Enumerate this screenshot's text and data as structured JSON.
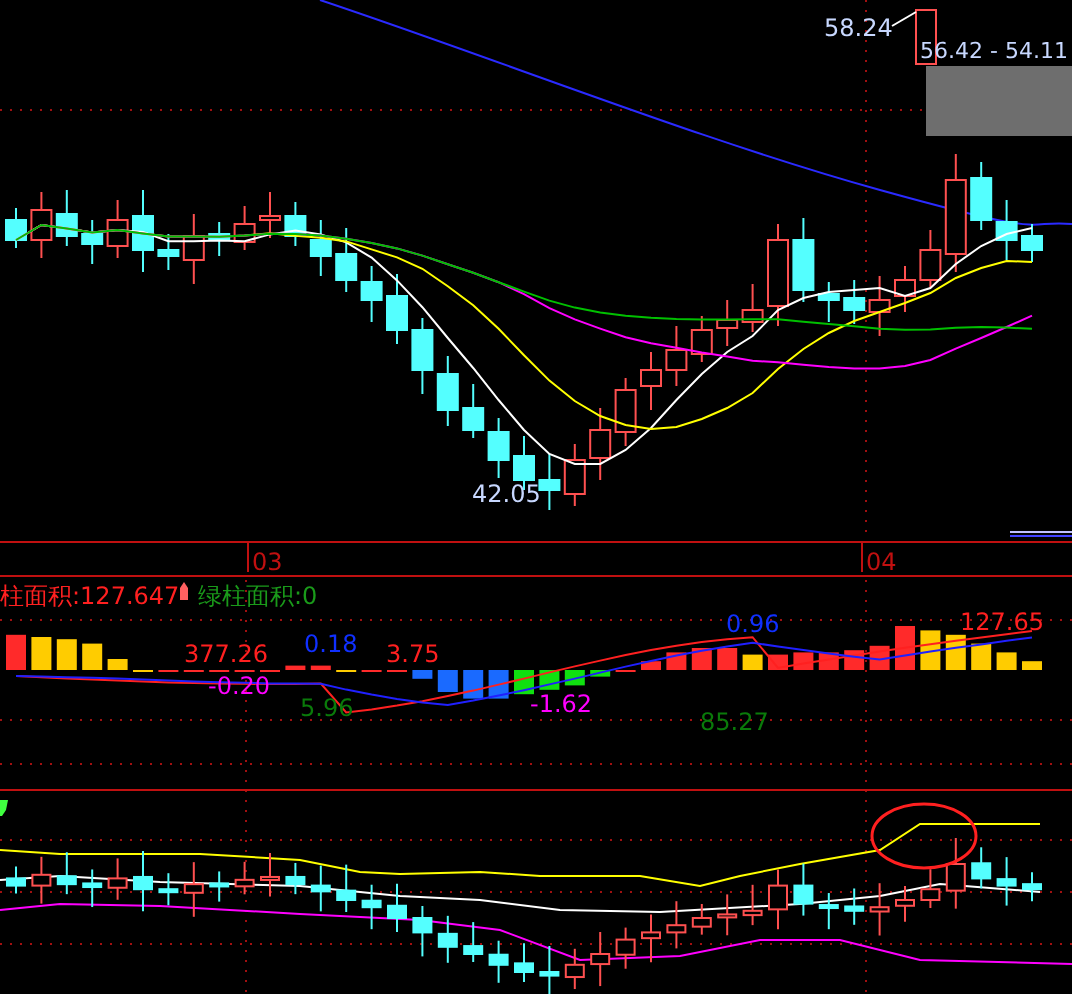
{
  "price_chart": {
    "high_label": "58.24",
    "range_label": "56.42 - 54.11",
    "low_label": "42.05"
  },
  "time_axis": {
    "labels": [
      "03",
      "04"
    ]
  },
  "indicator": {
    "legend": [
      {
        "text": "柱面积:127.647",
        "color": "#ff2020"
      },
      {
        "text": "绿柱面积:0",
        "color": "#1a9a1a"
      }
    ],
    "value_labels": [
      {
        "text": "377.26",
        "color": "#ff2020"
      },
      {
        "text": "-0.20",
        "color": "#ff00ff"
      },
      {
        "text": "0.18",
        "color": "#1030ff"
      },
      {
        "text": "3.75",
        "color": "#ff2020"
      },
      {
        "text": "5.96",
        "color": "#0a7a0a"
      },
      {
        "text": "-1.62",
        "color": "#ff00ff"
      },
      {
        "text": "0.96",
        "color": "#1030ff"
      },
      {
        "text": "85.27",
        "color": "#0a7a0a"
      },
      {
        "text": "127.65",
        "color": "#ff2020"
      }
    ]
  }
}
